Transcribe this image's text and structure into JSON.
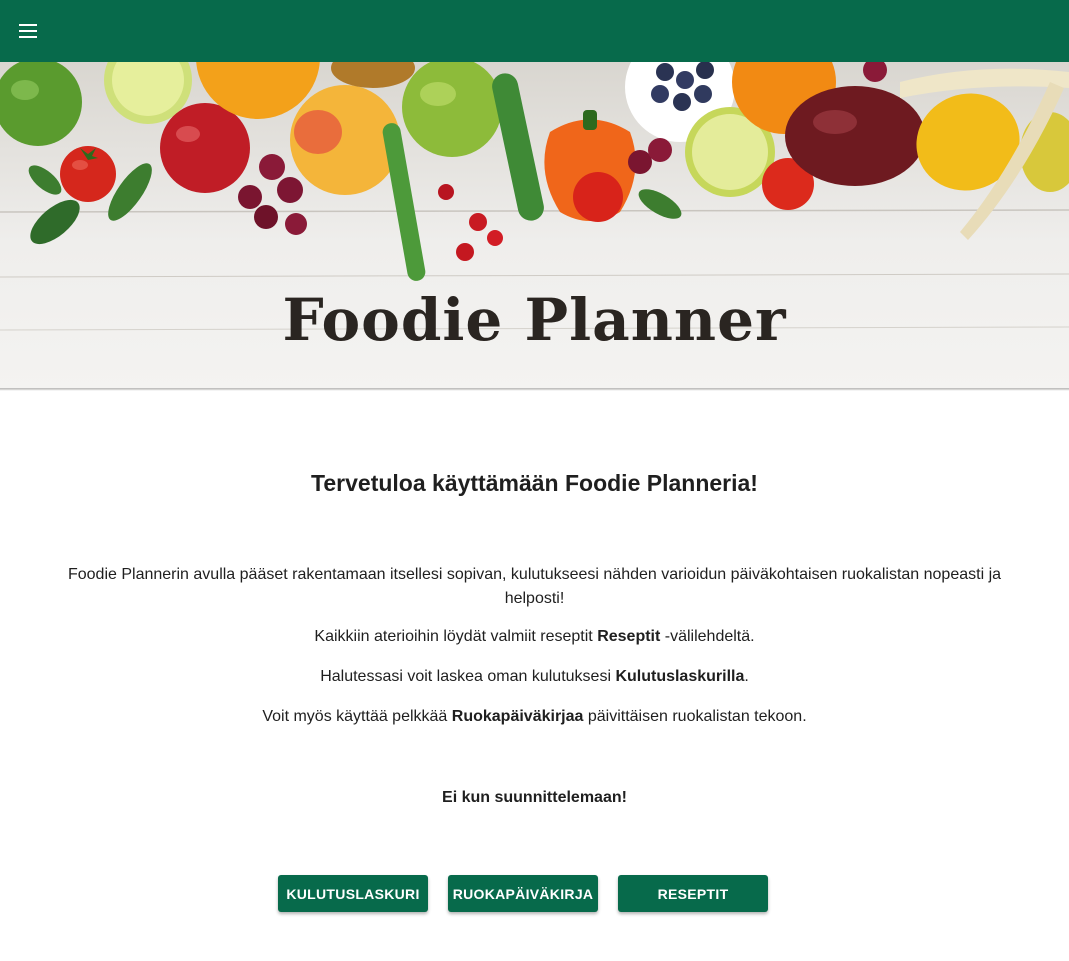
{
  "appbar": {
    "menu_icon": "menu-icon",
    "color": "#076a4b"
  },
  "hero": {
    "title": "Foodie Planner"
  },
  "main": {
    "welcome": "Tervetuloa käyttämään Foodie Planneria!",
    "intro": "Foodie Plannerin avulla pääset rakentamaan itsellesi sopivan, kulutukseesi nähden varioidun päiväkohtaisen ruokalistan nopeasti ja helposti!",
    "recipes_line": {
      "before": "Kaikkiin aterioihin löydät valmiit reseptit ",
      "bold": "Reseptit",
      "after": " -välilehdeltä."
    },
    "calc_line": {
      "before": "Halutessasi voit laskea oman kulutuksesi ",
      "bold": "Kulutuslaskurilla",
      "after": "."
    },
    "diary_line": {
      "before": "Voit myös käyttää pelkkää ",
      "bold": "Ruokapäiväkirjaa",
      "after": " päivittäisen ruokalistan tekoon."
    },
    "cta": "Ei kun suunnittelemaan!"
  },
  "buttons": {
    "calculator": "KULUTUSLASKURI",
    "diary": "RUOKAPÄIVÄKIRJA",
    "recipes": "RESEPTIT"
  }
}
